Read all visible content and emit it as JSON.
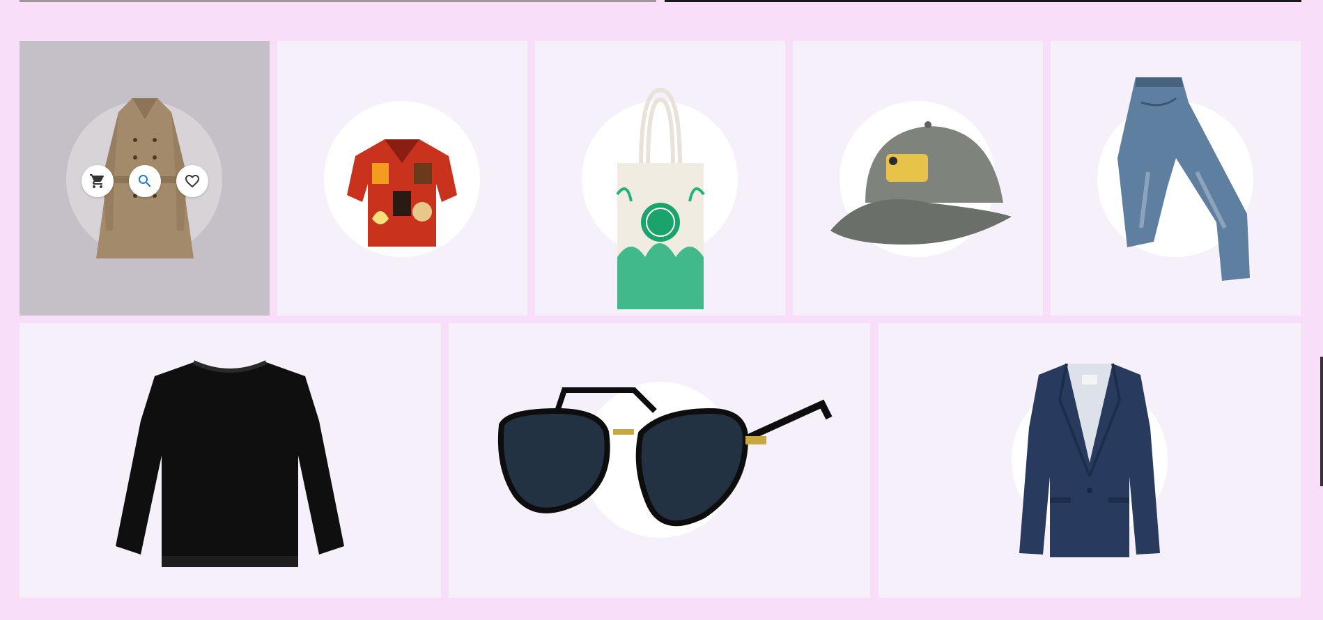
{
  "products": {
    "row1": [
      {
        "id": "trench-coat",
        "icon": "trench-coat-image",
        "hovered": true
      },
      {
        "id": "hawaiian-shirt",
        "icon": "shirt-image"
      },
      {
        "id": "tote-bag",
        "icon": "tote-bag-image"
      },
      {
        "id": "baseball-cap",
        "icon": "cap-image"
      },
      {
        "id": "jeans",
        "icon": "jeans-image"
      }
    ],
    "row2": [
      {
        "id": "sweatshirt",
        "icon": "sweatshirt-image"
      },
      {
        "id": "sunglasses",
        "icon": "sunglasses-image"
      },
      {
        "id": "blazer",
        "icon": "blazer-image"
      }
    ]
  },
  "hover_actions": [
    {
      "icon": "cart-icon"
    },
    {
      "icon": "search-icon"
    },
    {
      "icon": "heart-icon"
    }
  ],
  "colors": {
    "page": "#f9def9",
    "card": "#f6f0fa",
    "hover": "#c5c0c8",
    "accent": "#1976d2"
  }
}
